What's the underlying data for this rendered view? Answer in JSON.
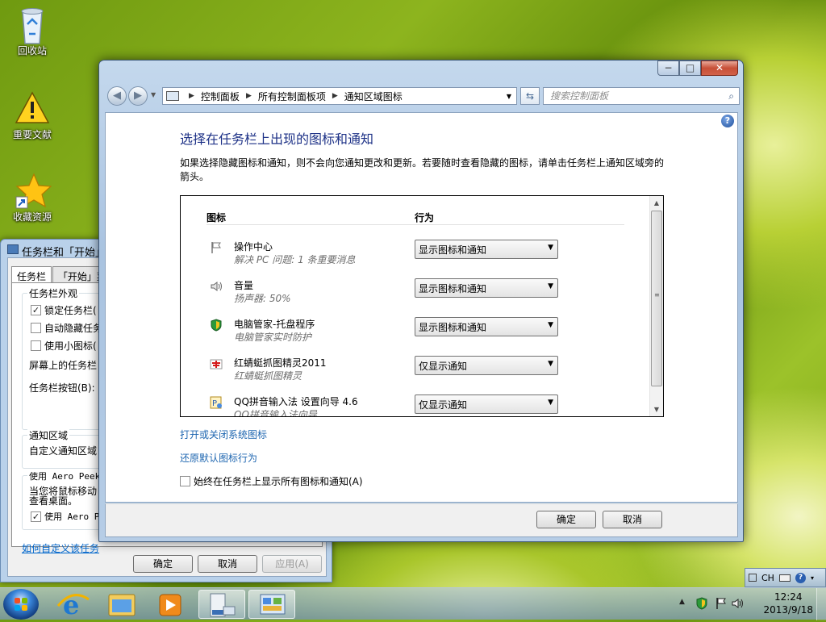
{
  "desktop": {
    "icons": [
      {
        "label": "回收站",
        "icon": "recycle-bin-icon"
      },
      {
        "label": "重要文献",
        "icon": "warning-icon"
      },
      {
        "label": "收藏资源",
        "icon": "star-shortcut-icon"
      }
    ]
  },
  "taskbar_dialog": {
    "title": "任务栏和「开始」菜",
    "tabs": [
      "任务栏",
      "「开始」菜"
    ],
    "group_appearance": "任务栏外观",
    "checks": [
      {
        "label": "锁定任务栏(",
        "checked": true
      },
      {
        "label": "自动隐藏任务",
        "checked": false
      },
      {
        "label": "使用小图标(",
        "checked": false
      }
    ],
    "screen_position_label": "屏幕上的任务栏",
    "buttons_label": "任务栏按钮(B):",
    "group_notify": "通知区域",
    "notify_text": "自定义通知区域",
    "aero_peek_title": "使用 Aero Peek",
    "aero_peek_text_1": "当您将鼠标移动",
    "aero_peek_text_2": "查看桌面。",
    "aero_peek_check": "使用 Aero Pe",
    "help_link": "如何自定义该任务",
    "ok": "确定",
    "cancel": "取消",
    "apply": "应用(A)"
  },
  "window": {
    "breadcrumb": [
      "控制面板",
      "所有控制面板项",
      "通知区域图标"
    ],
    "search_placeholder": "搜索控制面板",
    "help_icon": "?",
    "title": "选择在任务栏上出现的图标和通知",
    "description": "如果选择隐藏图标和通知，则不会向您通知更改和更新。若要随时查看隐藏的图标，请单击任务栏上通知区域旁的箭头。",
    "columns": [
      "图标",
      "行为"
    ],
    "rows": [
      {
        "name": "操作中心",
        "sub": "解决 PC 问题: 1 条重要消息",
        "behavior": "显示图标和通知",
        "icon": "flag-icon"
      },
      {
        "name": "音量",
        "sub": "扬声器: 50%",
        "behavior": "显示图标和通知",
        "icon": "speaker-icon"
      },
      {
        "name": "电脑管家-托盘程序",
        "sub": "电脑管家实时防护",
        "behavior": "显示图标和通知",
        "icon": "shield-icon"
      },
      {
        "name": "红蜻蜓抓图精灵2011",
        "sub": "红蜻蜓抓图精灵",
        "behavior": "仅显示通知",
        "icon": "dragonfly-icon"
      },
      {
        "name": "QQ拼音输入法 设置向导 4.6",
        "sub": "QQ拼音输入法向导",
        "behavior": "仅显示通知",
        "icon": "qq-pinyin-icon"
      }
    ],
    "link_system_icons": "打开或关闭系统图标",
    "link_restore": "还原默认图标行为",
    "always_show_label": "始终在任务栏上显示所有图标和通知(A)",
    "always_show_checked": false,
    "ok": "确定",
    "cancel": "取消"
  },
  "taskbar": {
    "tray_popup": {
      "lang": "CH",
      "help": "?"
    },
    "clock_time": "12:24",
    "clock_date": "2013/9/18"
  }
}
